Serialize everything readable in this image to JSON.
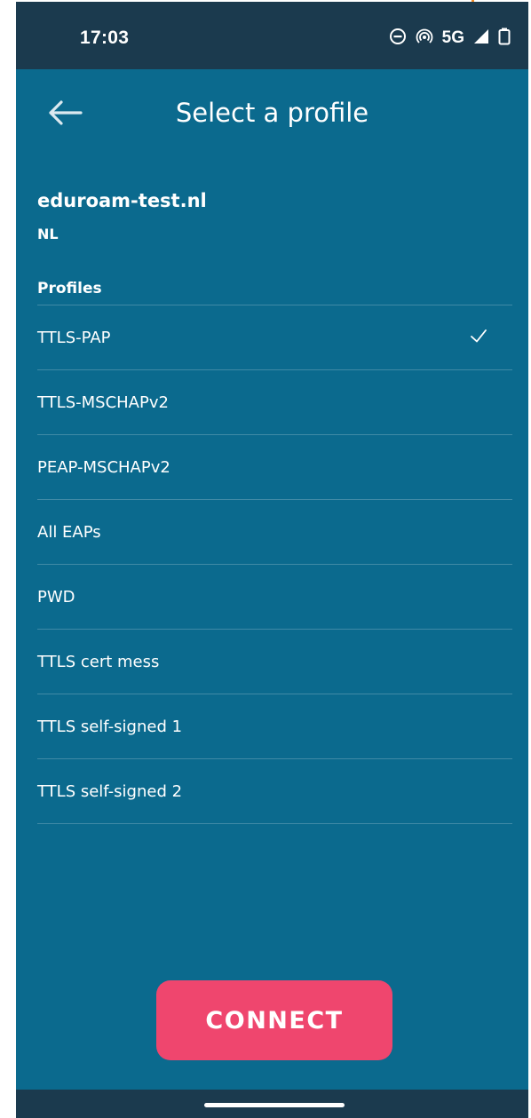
{
  "status_bar": {
    "time": "17:03",
    "network_label": "5G",
    "icons": [
      "do-not-disturb-icon",
      "hotspot-icon",
      "signal-icon",
      "battery-icon"
    ]
  },
  "app_bar": {
    "title": "Select a profile",
    "back_icon": "arrow-left-icon"
  },
  "institution": {
    "name": "eduroam-test.nl",
    "country": "NL"
  },
  "profiles": {
    "header": "Profiles",
    "items": [
      {
        "label": "TTLS-PAP",
        "selected": true
      },
      {
        "label": "TTLS-MSCHAPv2",
        "selected": false
      },
      {
        "label": "PEAP-MSCHAPv2",
        "selected": false
      },
      {
        "label": "All EAPs",
        "selected": false
      },
      {
        "label": "PWD",
        "selected": false
      },
      {
        "label": "TTLS cert mess",
        "selected": false
      },
      {
        "label": "TTLS self-signed 1",
        "selected": false
      },
      {
        "label": "TTLS self-signed 2",
        "selected": false
      }
    ]
  },
  "actions": {
    "connect_label": "CONNECT"
  },
  "colors": {
    "background": "#0b6a8e",
    "status_bar": "#1b3a4e",
    "accent": "#ef466e"
  }
}
